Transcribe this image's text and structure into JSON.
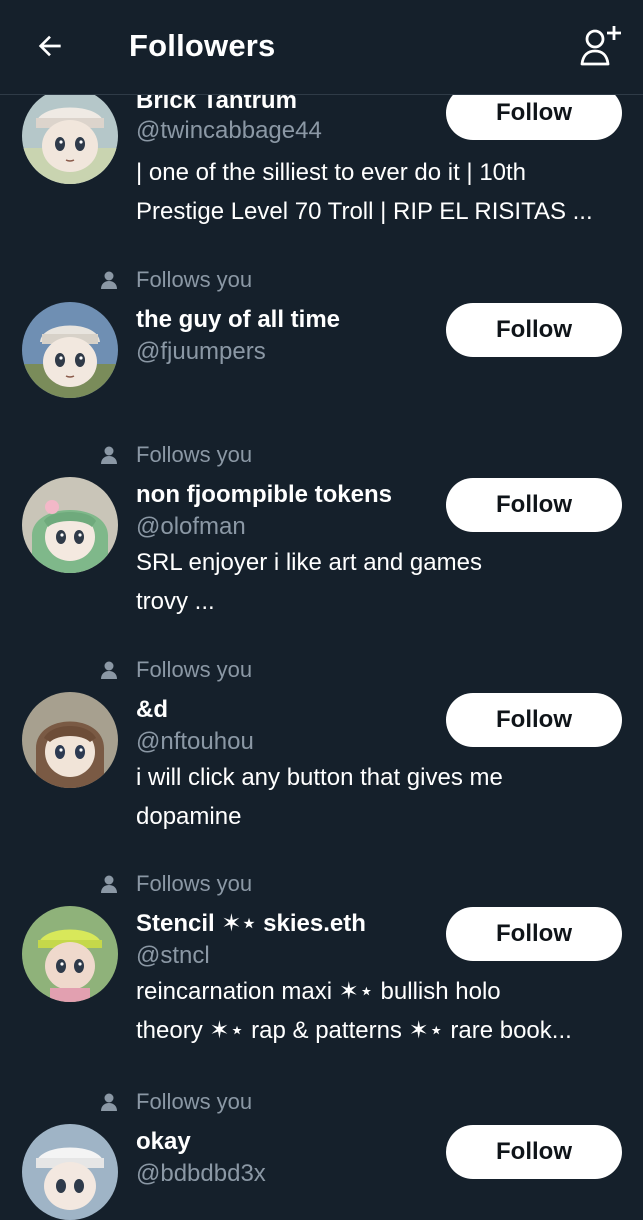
{
  "header": {
    "title": "Followers",
    "back_icon": "arrow-left-icon",
    "add_icon": "add-user-icon"
  },
  "colors": {
    "background": "#15202b",
    "secondary_text": "#8b98a5",
    "button_bg": "#ffffff",
    "button_text": "#0f1419"
  },
  "followers": [
    {
      "follows_you": "",
      "name": "Brick Tantrum",
      "handle": "@twincabbage44",
      "bio_lines": [
        "| one of the silliest to ever do it | 10th",
        "Prestige Level 70 Troll | RIP EL RISITAS ..."
      ],
      "button": "Follow"
    },
    {
      "follows_you": "Follows you",
      "name": "the guy of all time",
      "handle": "@fjuumpers",
      "bio_lines": [],
      "button": "Follow"
    },
    {
      "follows_you": "Follows you",
      "name": "non fjoompible tokens",
      "handle": "@olofman",
      "bio_lines": [
        "SRL enjoyer i like art and games",
        "trovy ..."
      ],
      "button": "Follow"
    },
    {
      "follows_you": "Follows you",
      "name": "&d",
      "handle": "@nftouhou",
      "bio_lines": [
        "i will click any button that gives me",
        "dopamine"
      ],
      "button": "Follow"
    },
    {
      "follows_you": "Follows you",
      "name": "Stencil ✶⋆ skies.eth",
      "handle": "@stncl",
      "bio_lines": [
        "reincarnation maxi ✶⋆ bullish holo",
        "theory ✶⋆ rap & patterns ✶⋆ rare book..."
      ],
      "button": "Follow"
    },
    {
      "follows_you": "Follows you",
      "name": "okay",
      "handle": "@bdbdbd3x",
      "bio_lines": [],
      "button": "Follow"
    }
  ]
}
